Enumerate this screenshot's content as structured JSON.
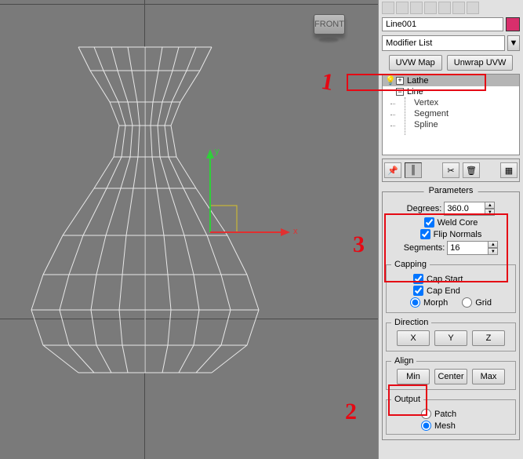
{
  "object_name": "Line001",
  "modifier_list_label": "Modifier List",
  "buttons": {
    "uvw_map": "UVW Map",
    "unwrap_uvw": "Unwrap UVW"
  },
  "stack": {
    "top": "Lathe",
    "base": "Line",
    "subs": [
      "Vertex",
      "Segment",
      "Spline"
    ]
  },
  "front_label": "FRONT",
  "axes": {
    "x": "x",
    "y": "y"
  },
  "parameters": {
    "title": "Parameters",
    "degrees_label": "Degrees:",
    "degrees_value": "360.0",
    "weld_core": "Weld Core",
    "flip_normals": "Flip Normals",
    "segments_label": "Segments:",
    "segments_value": "16"
  },
  "capping": {
    "title": "Capping",
    "cap_start": "Cap Start",
    "cap_end": "Cap End",
    "morph": "Morph",
    "grid": "Grid"
  },
  "direction": {
    "title": "Direction",
    "x": "X",
    "y": "Y",
    "z": "Z"
  },
  "align": {
    "title": "Align",
    "min": "Min",
    "center": "Center",
    "max": "Max"
  },
  "output": {
    "title": "Output",
    "patch": "Patch",
    "mesh": "Mesh"
  },
  "annotations": {
    "one": "1",
    "two": "2",
    "three": "3"
  }
}
